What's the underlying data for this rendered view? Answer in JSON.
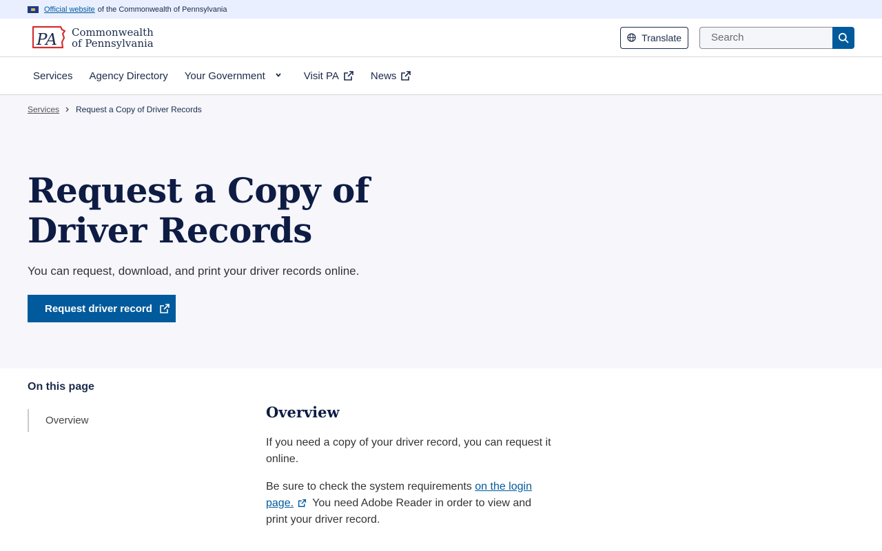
{
  "banner": {
    "link_text": "Official website",
    "suffix": "of the Commonwealth of Pennsylvania"
  },
  "header": {
    "logo_abbr": "PA",
    "logo_line1": "Commonwealth",
    "logo_line2": "of Pennsylvania",
    "translate_label": "Translate",
    "search_placeholder": "Search"
  },
  "nav": {
    "items": [
      {
        "label": "Services"
      },
      {
        "label": "Agency Directory"
      },
      {
        "label": "Your Government"
      },
      {
        "label": "Visit PA"
      },
      {
        "label": "News"
      }
    ]
  },
  "breadcrumb": {
    "parent": "Services",
    "current": "Request a Copy of Driver Records"
  },
  "hero": {
    "title": "Request a Copy of Driver Records",
    "subtitle": "You can request, download, and print your driver records online.",
    "cta_label": "Request driver record"
  },
  "toc": {
    "title": "On this page",
    "items": [
      {
        "label": "Overview"
      }
    ]
  },
  "overview": {
    "heading": "Overview",
    "p1": "If you need a copy of your driver record, you can request it online.",
    "p2_before": "Be sure to check the system requirements ",
    "p2_link": "on the login page.",
    "p2_after": " You need Adobe Reader in order to view and print your driver record."
  },
  "colors": {
    "primary": "#005a9c",
    "heading": "#0e1c44",
    "banner_bg": "#e9efff",
    "hero_bg": "#f6f6fb",
    "logo_red": "#d42f2f"
  }
}
